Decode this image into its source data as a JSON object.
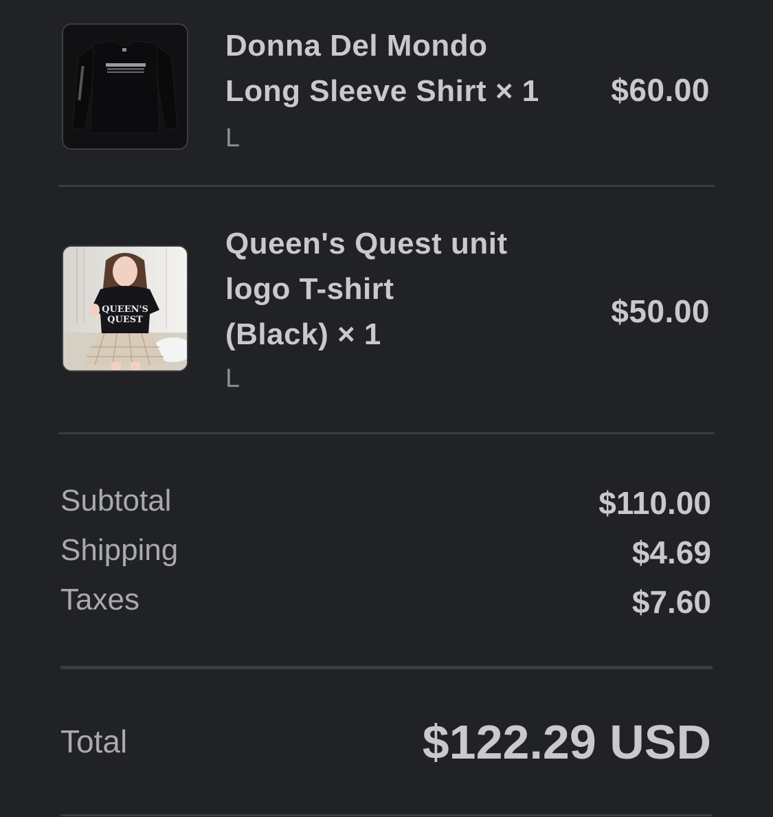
{
  "line_items": [
    {
      "title_line_1": "Donna Del Mondo",
      "title_line_2": "Long Sleeve Shirt × 1",
      "variant": "L",
      "price": "$60.00"
    },
    {
      "title_line_1": "Queen's Quest unit",
      "title_line_2": "logo T-shirt",
      "title_line_3": "(Black) × 1",
      "variant": "L",
      "price": "$50.00",
      "shirt_print_1": "QUEEN'S",
      "shirt_print_2": "QUEST"
    }
  ],
  "summary": {
    "subtotal_label": "Subtotal",
    "subtotal_value": "$110.00",
    "shipping_label": "Shipping",
    "shipping_value": "$4.69",
    "taxes_label": "Taxes",
    "taxes_value": "$7.60"
  },
  "total": {
    "label": "Total",
    "value": "$122.29 USD"
  },
  "colors": {
    "background": "#212226",
    "text_primary": "#c9c9cd",
    "text_secondary": "#8d8e93",
    "divider": "#3b3c41"
  }
}
